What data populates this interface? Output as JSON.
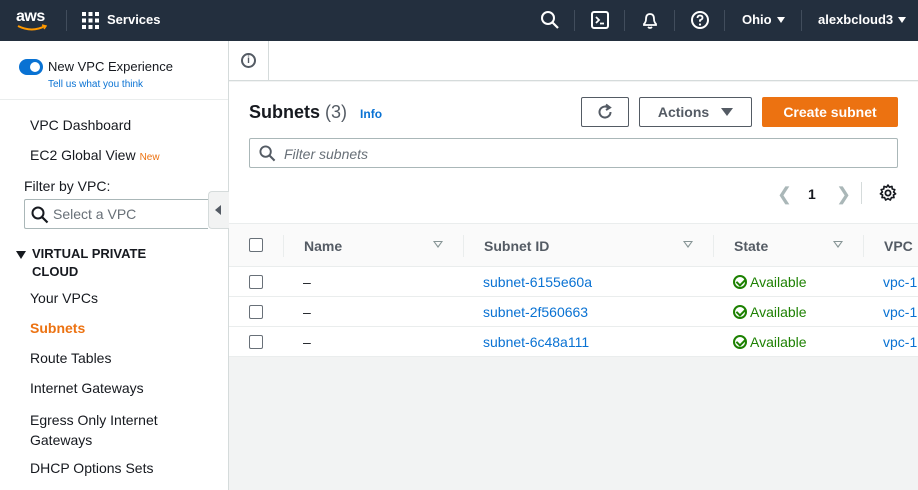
{
  "topnav": {
    "logo": "aws",
    "services_label": "Services",
    "icons": [
      "grid-icon",
      "search-icon",
      "cloudshell-icon",
      "bell-icon",
      "help-icon"
    ],
    "region": "Ohio",
    "user": "alexbcloud3"
  },
  "sidebar": {
    "toggle_label": "New VPC Experience",
    "toggle_on": true,
    "feedback_link": "Tell us what you think",
    "dashboard": "VPC Dashboard",
    "ec2_global_view": "EC2 Global View",
    "new_badge": "New",
    "filter_label": "Filter by VPC:",
    "filter_placeholder": "Select a VPC",
    "section_title": "VIRTUAL PRIVATE CLOUD",
    "items": [
      {
        "label": "Your VPCs",
        "active": false
      },
      {
        "label": "Subnets",
        "active": true
      },
      {
        "label": "Route Tables",
        "active": false
      },
      {
        "label": "Internet Gateways",
        "active": false
      },
      {
        "label": "Egress Only Internet Gateways",
        "active": false
      },
      {
        "label": "DHCP Options Sets",
        "active": false
      }
    ]
  },
  "main": {
    "title": "Subnets",
    "count": "(3)",
    "info_link": "Info",
    "actions_label": "Actions",
    "create_label": "Create subnet",
    "search_placeholder": "Filter subnets",
    "page": "1",
    "columns": [
      "Name",
      "Subnet ID",
      "State",
      "VPC"
    ],
    "rows": [
      {
        "name": "–",
        "subnet_id": "subnet-6155e60a",
        "state": "Available",
        "vpc": "vpc-1"
      },
      {
        "name": "–",
        "subnet_id": "subnet-2f560663",
        "state": "Available",
        "vpc": "vpc-1"
      },
      {
        "name": "–",
        "subnet_id": "subnet-6c48a111",
        "state": "Available",
        "vpc": "vpc-1"
      }
    ]
  },
  "colors": {
    "nav_bg": "#232f3e",
    "accent_orange": "#ec7211",
    "link_blue": "#0972d3",
    "success_green": "#1d8102"
  }
}
